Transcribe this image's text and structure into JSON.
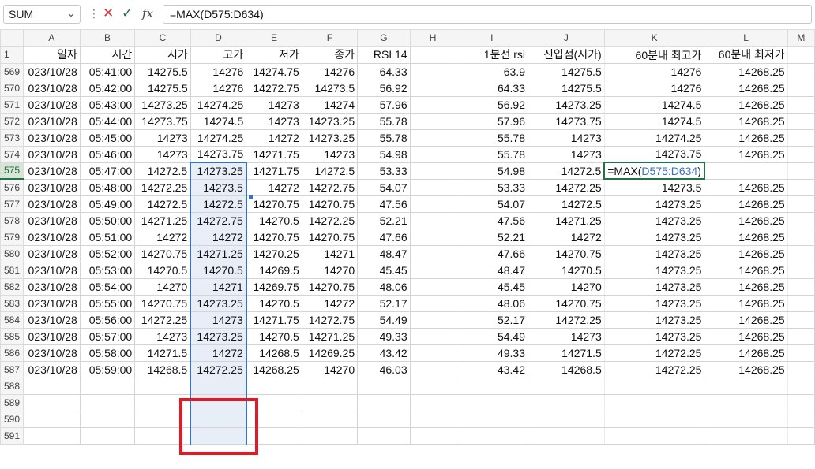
{
  "formula_bar": {
    "name_box": "SUM",
    "cancel_icon": "✕",
    "enter_icon": "✓",
    "fx_label": "fx",
    "formula": "=MAX(D575:D634)"
  },
  "columns": [
    "A",
    "B",
    "C",
    "D",
    "E",
    "F",
    "G",
    "H",
    "I",
    "J",
    "K",
    "L",
    "M"
  ],
  "header_row": {
    "row_num": "1",
    "A": "일자",
    "B": "시간",
    "C": "시가",
    "D": "고가",
    "E": "저가",
    "F": "종가",
    "G": "RSI 14",
    "H": "",
    "I": "1분전 rsi",
    "J": "진입점(시가)",
    "K": "60분내 최고가",
    "L": "60분내 최저가"
  },
  "rows": [
    {
      "n": "569",
      "A": "023/10/28",
      "B": "05:41:00",
      "C": "14275.5",
      "D": "14276",
      "E": "14274.75",
      "F": "14276",
      "G": "64.33",
      "I": "63.9",
      "J": "14275.5",
      "K": "14276",
      "L": "14268.25"
    },
    {
      "n": "570",
      "A": "023/10/28",
      "B": "05:42:00",
      "C": "14275.5",
      "D": "14276",
      "E": "14272.75",
      "F": "14273.5",
      "G": "56.92",
      "I": "64.33",
      "J": "14275.5",
      "K": "14276",
      "L": "14268.25"
    },
    {
      "n": "571",
      "A": "023/10/28",
      "B": "05:43:00",
      "C": "14273.25",
      "D": "14274.25",
      "E": "14273",
      "F": "14274",
      "G": "57.96",
      "I": "56.92",
      "J": "14273.25",
      "K": "14274.5",
      "L": "14268.25"
    },
    {
      "n": "572",
      "A": "023/10/28",
      "B": "05:44:00",
      "C": "14273.75",
      "D": "14274.5",
      "E": "14273",
      "F": "14273.25",
      "G": "55.78",
      "I": "57.96",
      "J": "14273.75",
      "K": "14274.5",
      "L": "14268.25"
    },
    {
      "n": "573",
      "A": "023/10/28",
      "B": "05:45:00",
      "C": "14273",
      "D": "14274.25",
      "E": "14272",
      "F": "14273.25",
      "G": "55.78",
      "I": "55.78",
      "J": "14273",
      "K": "14274.25",
      "L": "14268.25"
    },
    {
      "n": "574",
      "A": "023/10/28",
      "B": "05:46:00",
      "C": "14273",
      "D": "14273.75",
      "E": "14271.75",
      "F": "14273",
      "G": "54.98",
      "I": "55.78",
      "J": "14273",
      "K": "14273.75",
      "L": "14268.25"
    },
    {
      "n": "575",
      "A": "023/10/28",
      "B": "05:47:00",
      "C": "14272.5",
      "D": "14273.25",
      "E": "14271.75",
      "F": "14272.5",
      "G": "53.33",
      "I": "54.98",
      "J": "14272.5",
      "K": "",
      "L": ""
    },
    {
      "n": "576",
      "A": "023/10/28",
      "B": "05:48:00",
      "C": "14272.25",
      "D": "14273.5",
      "E": "14272",
      "F": "14272.75",
      "G": "54.07",
      "I": "53.33",
      "J": "14272.25",
      "K": "14273.5",
      "L": "14268.25"
    },
    {
      "n": "577",
      "A": "023/10/28",
      "B": "05:49:00",
      "C": "14272.5",
      "D": "14272.5",
      "E": "14270.75",
      "F": "14270.75",
      "G": "47.56",
      "I": "54.07",
      "J": "14272.5",
      "K": "14273.25",
      "L": "14268.25"
    },
    {
      "n": "578",
      "A": "023/10/28",
      "B": "05:50:00",
      "C": "14271.25",
      "D": "14272.75",
      "E": "14270.5",
      "F": "14272.25",
      "G": "52.21",
      "I": "47.56",
      "J": "14271.25",
      "K": "14273.25",
      "L": "14268.25"
    },
    {
      "n": "579",
      "A": "023/10/28",
      "B": "05:51:00",
      "C": "14272",
      "D": "14272",
      "E": "14270.75",
      "F": "14270.75",
      "G": "47.66",
      "I": "52.21",
      "J": "14272",
      "K": "14273.25",
      "L": "14268.25"
    },
    {
      "n": "580",
      "A": "023/10/28",
      "B": "05:52:00",
      "C": "14270.75",
      "D": "14271.25",
      "E": "14270.25",
      "F": "14271",
      "G": "48.47",
      "I": "47.66",
      "J": "14270.75",
      "K": "14273.25",
      "L": "14268.25"
    },
    {
      "n": "581",
      "A": "023/10/28",
      "B": "05:53:00",
      "C": "14270.5",
      "D": "14270.5",
      "E": "14269.5",
      "F": "14270",
      "G": "45.45",
      "I": "48.47",
      "J": "14270.5",
      "K": "14273.25",
      "L": "14268.25"
    },
    {
      "n": "582",
      "A": "023/10/28",
      "B": "05:54:00",
      "C": "14270",
      "D": "14271",
      "E": "14269.75",
      "F": "14270.75",
      "G": "48.06",
      "I": "45.45",
      "J": "14270",
      "K": "14273.25",
      "L": "14268.25"
    },
    {
      "n": "583",
      "A": "023/10/28",
      "B": "05:55:00",
      "C": "14270.75",
      "D": "14273.25",
      "E": "14270.5",
      "F": "14272",
      "G": "52.17",
      "I": "48.06",
      "J": "14270.75",
      "K": "14273.25",
      "L": "14268.25"
    },
    {
      "n": "584",
      "A": "023/10/28",
      "B": "05:56:00",
      "C": "14272.25",
      "D": "14273",
      "E": "14271.75",
      "F": "14272.75",
      "G": "54.49",
      "I": "52.17",
      "J": "14272.25",
      "K": "14273.25",
      "L": "14268.25"
    },
    {
      "n": "585",
      "A": "023/10/28",
      "B": "05:57:00",
      "C": "14273",
      "D": "14273.25",
      "E": "14270.5",
      "F": "14271.25",
      "G": "49.33",
      "I": "54.49",
      "J": "14273",
      "K": "14273.25",
      "L": "14268.25"
    },
    {
      "n": "586",
      "A": "023/10/28",
      "B": "05:58:00",
      "C": "14271.5",
      "D": "14272",
      "E": "14268.5",
      "F": "14269.25",
      "G": "43.42",
      "I": "49.33",
      "J": "14271.5",
      "K": "14272.25",
      "L": "14268.25"
    },
    {
      "n": "587",
      "A": "023/10/28",
      "B": "05:59:00",
      "C": "14268.5",
      "D": "14272.25",
      "E": "14268.25",
      "F": "14270",
      "G": "46.03",
      "I": "43.42",
      "J": "14268.5",
      "K": "14272.25",
      "L": "14268.25"
    },
    {
      "n": "588",
      "A": "",
      "B": "",
      "C": "",
      "D": "",
      "E": "",
      "F": "",
      "G": "",
      "I": "",
      "J": "",
      "K": "",
      "L": ""
    },
    {
      "n": "589",
      "A": "",
      "B": "",
      "C": "",
      "D": "",
      "E": "",
      "F": "",
      "G": "",
      "I": "",
      "J": "",
      "K": "",
      "L": ""
    },
    {
      "n": "590",
      "A": "",
      "B": "",
      "C": "",
      "D": "",
      "E": "",
      "F": "",
      "G": "",
      "I": "",
      "J": "",
      "K": "",
      "L": ""
    },
    {
      "n": "591",
      "A": "",
      "B": "",
      "C": "",
      "D": "",
      "E": "",
      "F": "",
      "G": "",
      "I": "",
      "J": "",
      "K": "",
      "L": ""
    }
  ],
  "edit_cell": {
    "row": "575",
    "column": "K",
    "prefix": "=MAX(",
    "ref": "D575:D634",
    "suffix": ")"
  },
  "colors": {
    "accent": "#217346",
    "selection": "#3b6fc6",
    "highlight_box": "#e01b24"
  }
}
